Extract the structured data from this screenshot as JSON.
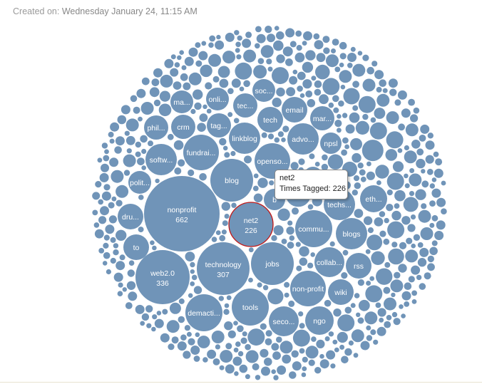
{
  "header": {
    "created_label": "Created on:",
    "created_value": "Wednesday January 24, 11:15 AM"
  },
  "tooltip": {
    "title": "net2",
    "metric_label": "Times Tagged:",
    "metric_value": "226"
  },
  "colors": {
    "bubble": "#7094b8",
    "selected_stroke": "#c01818",
    "label": "#ffffff"
  },
  "chart_data": {
    "type": "bubble",
    "metric": "Times Tagged",
    "selected": "net2",
    "bubbles": [
      {
        "tag": "nonprofit",
        "value": 662,
        "label": "nonprofit"
      },
      {
        "tag": "web2.0",
        "value": 336,
        "label": "web2.0"
      },
      {
        "tag": "technology",
        "value": 307,
        "label": "technology"
      },
      {
        "tag": "net2",
        "value": 226,
        "label": "net2"
      },
      {
        "tag": "blog",
        "label": "blog"
      },
      {
        "tag": "jobs",
        "label": "jobs"
      },
      {
        "tag": "demacti",
        "label": "demacti..."
      },
      {
        "tag": "tools",
        "label": "tools"
      },
      {
        "tag": "commu",
        "label": "commu..."
      },
      {
        "tag": "non-profit",
        "label": "non-profit"
      },
      {
        "tag": "fundrai",
        "label": "fundrai..."
      },
      {
        "tag": "openso",
        "label": "openso..."
      },
      {
        "tag": "blogs",
        "label": "blogs"
      },
      {
        "tag": "softw",
        "label": "softw..."
      },
      {
        "tag": "linkblog",
        "label": "linkblog"
      },
      {
        "tag": "advo",
        "label": "advo..."
      },
      {
        "tag": "techs",
        "label": "techs..."
      },
      {
        "tag": "seco",
        "label": "seco..."
      },
      {
        "tag": "collab",
        "label": "collab..."
      },
      {
        "tag": "ngo",
        "label": "ngo"
      },
      {
        "tag": "eth",
        "label": "eth..."
      },
      {
        "tag": "dru",
        "label": "dru..."
      },
      {
        "tag": "to",
        "label": "to"
      },
      {
        "tag": "rss",
        "label": "rss"
      },
      {
        "tag": "wiki",
        "label": "wiki"
      },
      {
        "tag": "tech",
        "label": "tech"
      },
      {
        "tag": "email",
        "label": "email"
      },
      {
        "tag": "tec",
        "label": "tec..."
      },
      {
        "tag": "tag",
        "label": "tag..."
      },
      {
        "tag": "crm",
        "label": "crm"
      },
      {
        "tag": "phil",
        "label": "phil..."
      },
      {
        "tag": "ma",
        "label": "ma..."
      },
      {
        "tag": "onli",
        "label": "onli..."
      },
      {
        "tag": "soc",
        "label": "soc..."
      },
      {
        "tag": "mar",
        "label": "mar..."
      },
      {
        "tag": "npsl",
        "label": "npsl"
      },
      {
        "tag": "polit",
        "label": "polit..."
      },
      {
        "tag": "b",
        "label": "b"
      }
    ]
  }
}
